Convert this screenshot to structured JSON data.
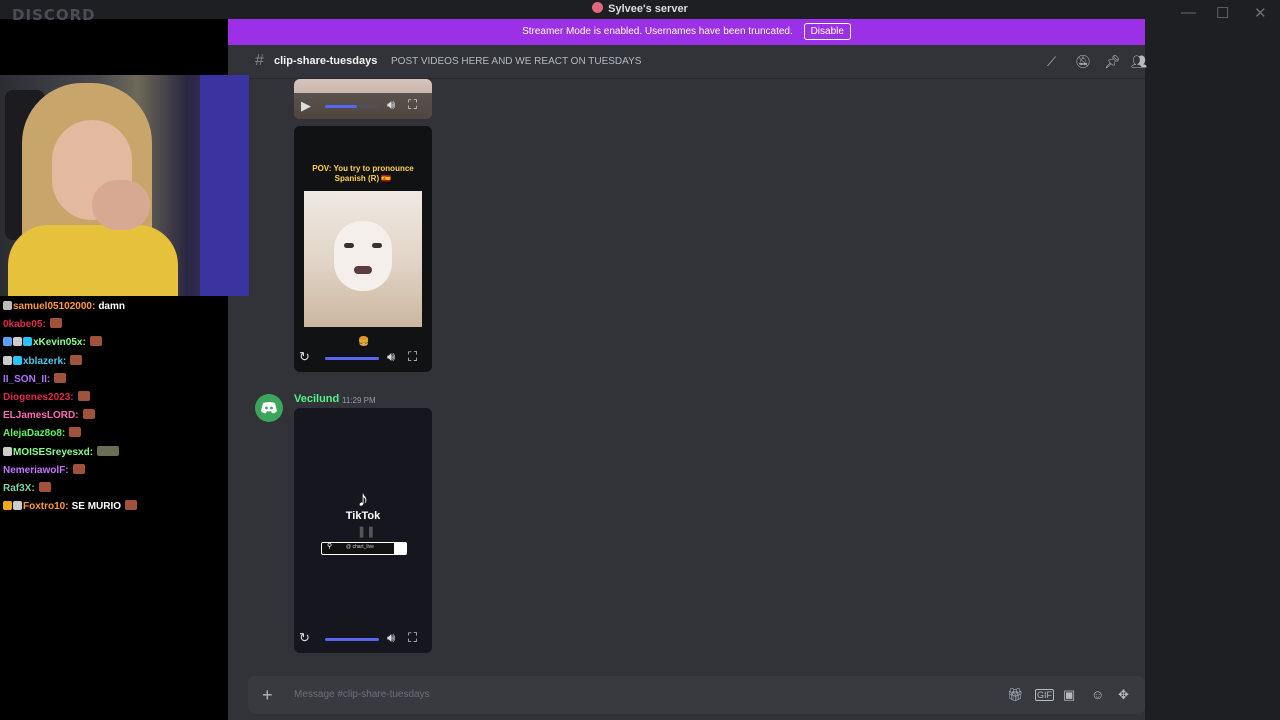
{
  "app": {
    "logo": "DISCORD",
    "server_name": "Sylvee's server",
    "window_controls": {
      "minimize": "—",
      "maximize": "☐",
      "close": "✕"
    }
  },
  "banner": {
    "text": "Streamer Mode is enabled. Usernames have been truncated.",
    "button": "Disable"
  },
  "channel": {
    "name": "clip-share-tuesdays",
    "topic": "POST VIDEOS HERE AND WE REACT ON TUESDAYS",
    "header_icons": [
      "threads-icon",
      "mute-bell-icon",
      "pin-icon",
      "members-icon"
    ]
  },
  "messages": {
    "video2": {
      "caption": "POV: You try to pronounce Spanish (R) 🇪🇸"
    },
    "author": "Vecilund",
    "timestamp": "11:29 PM",
    "video3": {
      "brand": "TikTok",
      "handle": "@ chart_live"
    }
  },
  "composer": {
    "placeholder": "Message #clip-share-tuesdays",
    "icons": [
      "gift-icon",
      "gif-icon",
      "sticker-icon",
      "emoji-icon",
      "apps-icon"
    ]
  },
  "twitch_chat": [
    {
      "user": "samuel05102000",
      "color": "#ff9a3c",
      "text": "damn",
      "badges": [
        "#bbbbbb"
      ],
      "emote": false
    },
    {
      "user": "0kabe05",
      "color": "#e0294b",
      "text": "",
      "badges": [],
      "emote": true
    },
    {
      "user": "xKevin05x",
      "color": "#8aff8a",
      "text": "",
      "badges": [
        "#5aa0ff",
        "#cccccc",
        "#2bc3ff"
      ],
      "emote": true
    },
    {
      "user": "xblazerk",
      "color": "#4ec9f0",
      "text": "",
      "badges": [
        "#cccccc",
        "#2bc3ff"
      ],
      "emote": true
    },
    {
      "user": "II_SON_II",
      "color": "#b072ff",
      "text": "",
      "badges": [],
      "emote": true
    },
    {
      "user": "Diogenes2023",
      "color": "#e0294b",
      "text": "",
      "badges": [],
      "emote": true
    },
    {
      "user": "ELJamesLORD",
      "color": "#ff69b4",
      "text": "",
      "badges": [],
      "emote": true
    },
    {
      "user": "AlejaDaz8o8",
      "color": "#5ef55e",
      "text": "",
      "badges": [],
      "emote": true
    },
    {
      "user": "MOISESreyesxd",
      "color": "#8aff8a",
      "text": "",
      "badges": [
        "#cccccc"
      ],
      "emote": true
    },
    {
      "user": "NemeriawolF",
      "color": "#c476ff",
      "text": "",
      "badges": [],
      "emote": true
    },
    {
      "user": "Raf3X",
      "color": "#7dd3a8",
      "text": "",
      "badges": [],
      "emote": true
    },
    {
      "user": "Foxtro10",
      "color": "#ff9a3c",
      "text": "SE MURIO",
      "badges": [
        "#f5a623",
        "#cccccc"
      ],
      "emote": true
    }
  ]
}
